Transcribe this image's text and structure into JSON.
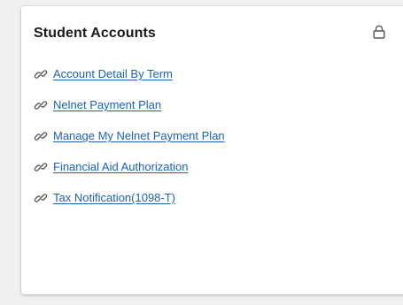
{
  "card": {
    "title": "Student Accounts",
    "lock_icon": "lock-icon",
    "links": [
      {
        "label": "Account Detail By Term",
        "icon": "link-icon"
      },
      {
        "label": "Nelnet Payment Plan",
        "icon": "link-icon"
      },
      {
        "label": "Manage My Nelnet Payment Plan",
        "icon": "link-icon"
      },
      {
        "label": "Financial Aid Authorization",
        "icon": "link-icon"
      },
      {
        "label": "Tax Notification(1098-T)",
        "icon": "link-icon"
      }
    ]
  },
  "colors": {
    "link": "#1a62b8",
    "title": "#1a1a1a",
    "background": "#f0f0f0",
    "card": "#ffffff"
  }
}
